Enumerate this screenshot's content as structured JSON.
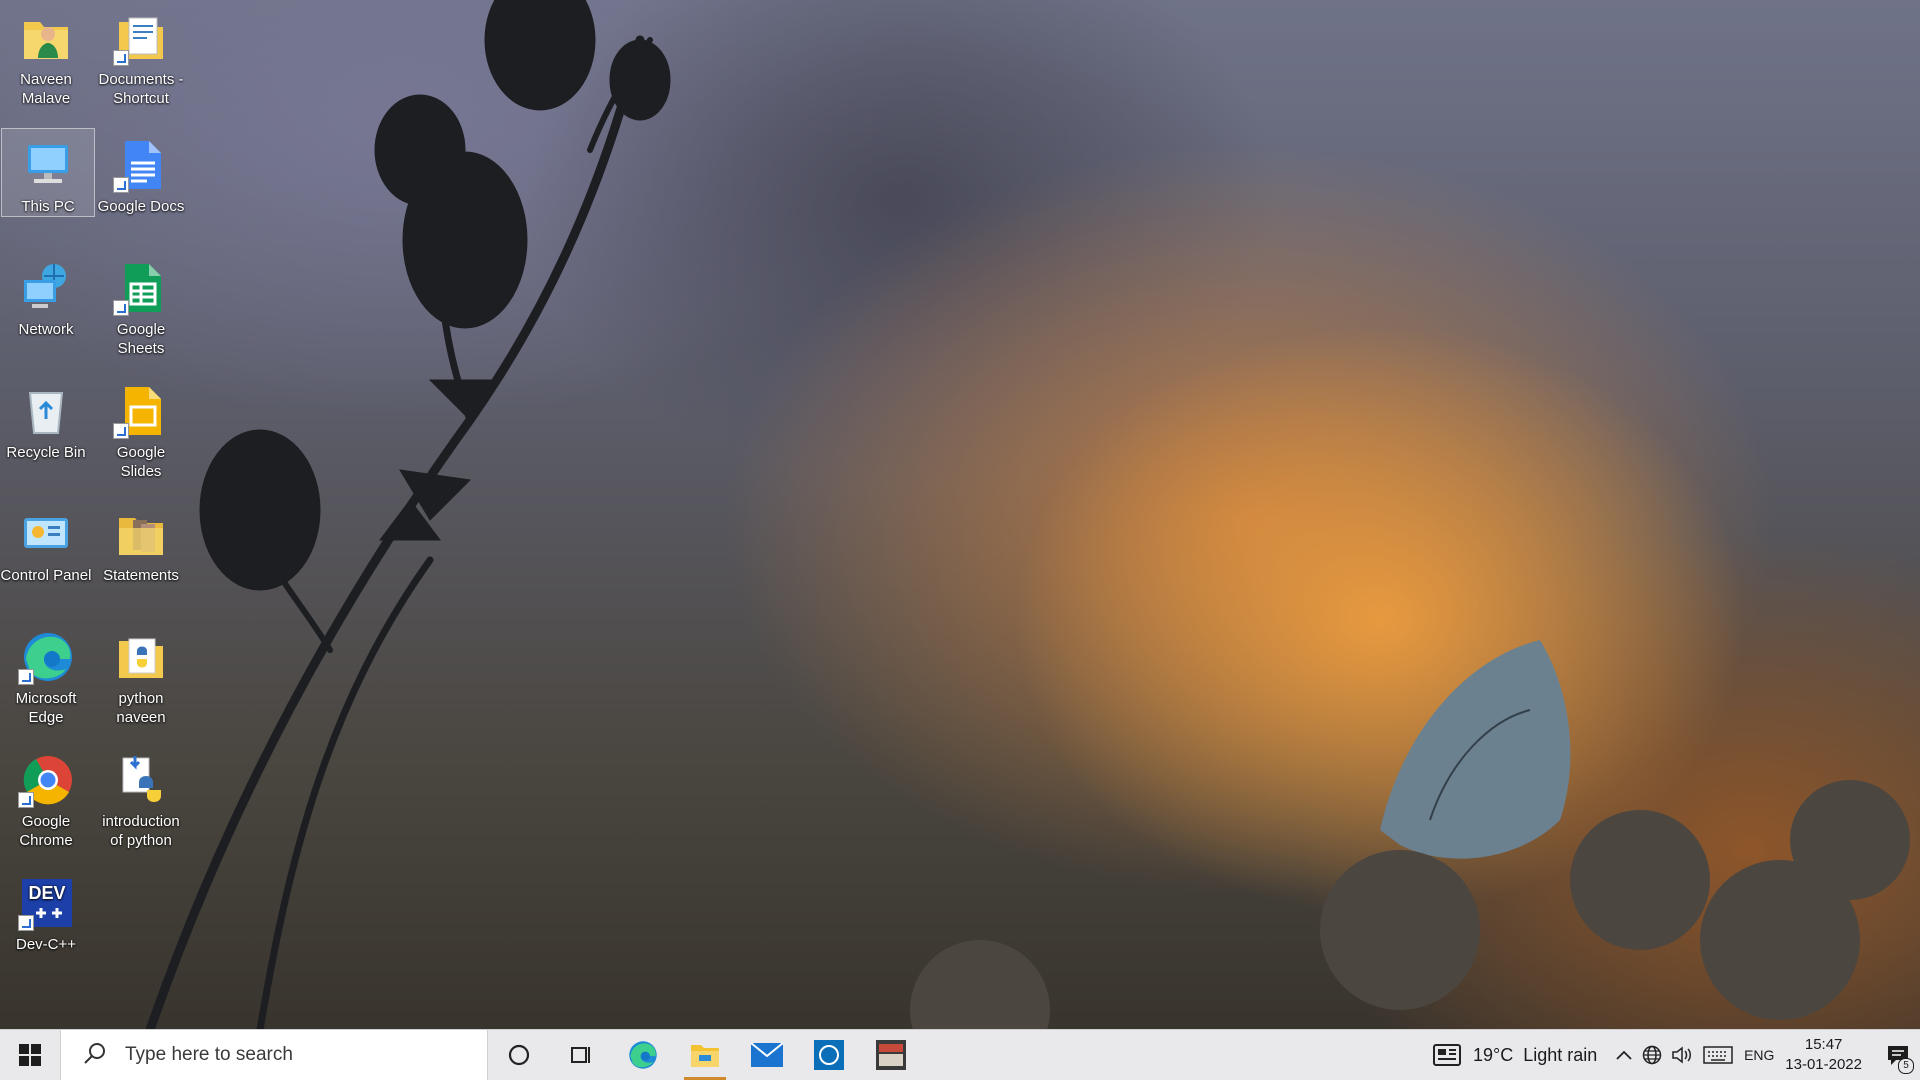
{
  "desktop": {
    "icons": [
      {
        "label": "Naveen Malave",
        "icon": "user-folder-icon"
      },
      {
        "label": "Documents - Shortcut",
        "icon": "documents-shortcut-icon"
      },
      {
        "label": "This PC",
        "icon": "this-pc-icon"
      },
      {
        "label": "Google Docs",
        "icon": "google-docs-icon"
      },
      {
        "label": "Network",
        "icon": "network-icon"
      },
      {
        "label": "Google Sheets",
        "icon": "google-sheets-icon"
      },
      {
        "label": "Recycle Bin",
        "icon": "recycle-bin-icon"
      },
      {
        "label": "Google Slides",
        "icon": "google-slides-icon"
      },
      {
        "label": "Control Panel",
        "icon": "control-panel-icon"
      },
      {
        "label": "Statements",
        "icon": "folder-icon"
      },
      {
        "label": "Microsoft Edge",
        "icon": "edge-icon"
      },
      {
        "label": "python naveen",
        "icon": "python-folder-icon"
      },
      {
        "label": "Google Chrome",
        "icon": "chrome-icon"
      },
      {
        "label": "introduction of python",
        "icon": "python-file-icon"
      },
      {
        "label": "Dev-C++",
        "icon": "devcpp-icon"
      }
    ],
    "selected": "This PC"
  },
  "taskbar": {
    "search_placeholder": "Type here to search",
    "pinned": [
      "cortana-icon",
      "task-view-icon",
      "edge-icon",
      "file-explorer-icon",
      "mail-icon",
      "dell-icon",
      "app-icon"
    ],
    "active_app": "file-explorer-icon"
  },
  "tray": {
    "weather_temp": "19°C",
    "weather_text": "Light rain",
    "language": "ENG",
    "time": "15:47",
    "date": "13-01-2022",
    "notifications": "5"
  },
  "colors": {
    "taskbar_bg": "#e9e9ec",
    "active_indicator": "#d08a2b",
    "start_blue": "#2b6fd1"
  }
}
